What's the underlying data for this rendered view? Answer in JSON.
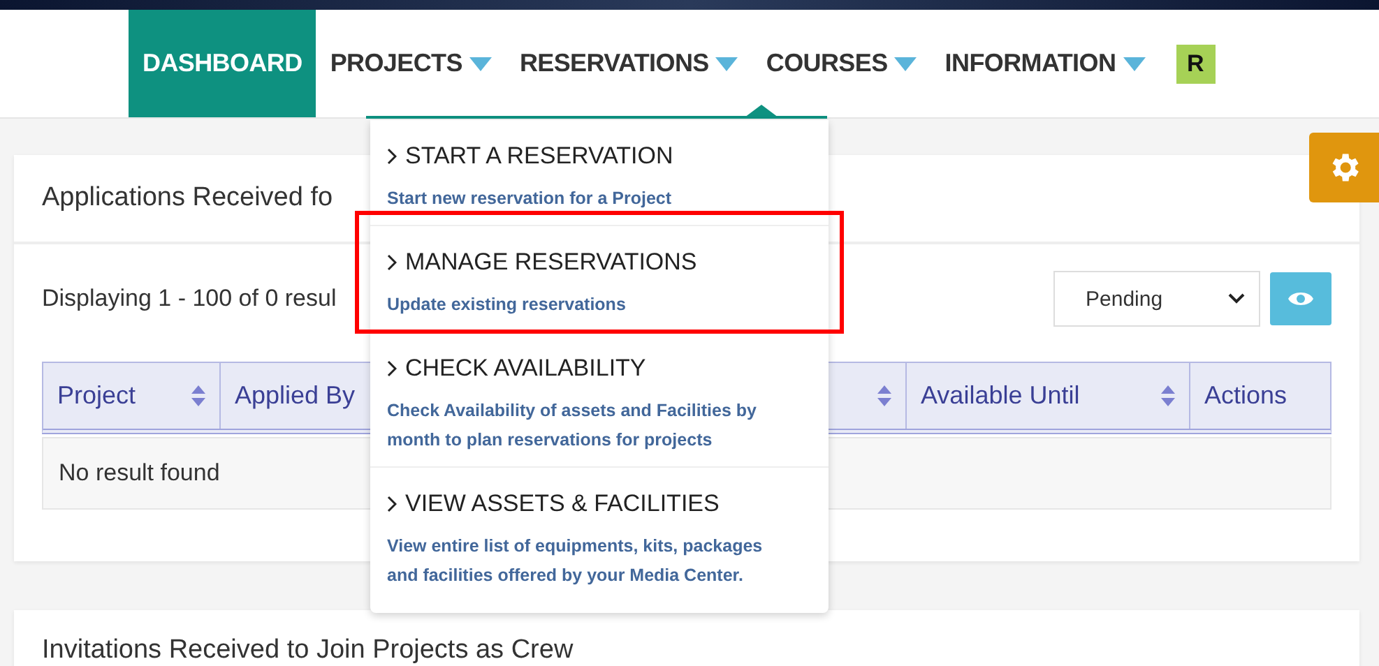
{
  "top_nav": {
    "items": [
      {
        "label": "DASHBOARD",
        "selected": true,
        "has_caret": false
      },
      {
        "label": "PROJECTS",
        "selected": false,
        "has_caret": true
      },
      {
        "label": "RESERVATIONS",
        "selected": false,
        "has_caret": true
      },
      {
        "label": "COURSES",
        "selected": false,
        "has_caret": true
      },
      {
        "label": "INFORMATION",
        "selected": false,
        "has_caret": true
      }
    ],
    "avatar": "R"
  },
  "reservations_menu": {
    "items": [
      {
        "title": "START A RESERVATION",
        "description": "Start new reservation for a Project",
        "highlighted": false
      },
      {
        "title": "MANAGE RESERVATIONS",
        "description": "Update existing reservations",
        "highlighted": true
      },
      {
        "title": "CHECK AVAILABILITY",
        "description": "Check Availability of assets and Facilities by month to plan reservations for projects",
        "highlighted": false
      },
      {
        "title": "VIEW ASSETS & FACILITIES",
        "description": "View entire list of equipments, kits, packages and facilities offered by your Media Center.",
        "highlighted": false
      }
    ]
  },
  "applications_card": {
    "title": "Applications Received fo",
    "summary": "Displaying 1 - 100 of 0 resul",
    "status_filter": {
      "value": "Pending"
    },
    "table": {
      "columns": [
        {
          "label": "Project",
          "sortable": true
        },
        {
          "label": "Applied By"
        },
        {
          "sortable": true
        },
        {
          "label": "Available Until",
          "sortable": true
        },
        {
          "label": "Actions",
          "sortable": false
        }
      ],
      "empty_message": "No result found"
    }
  },
  "invitations_card": {
    "title": "Invitations Received to Join Projects as Crew"
  }
}
